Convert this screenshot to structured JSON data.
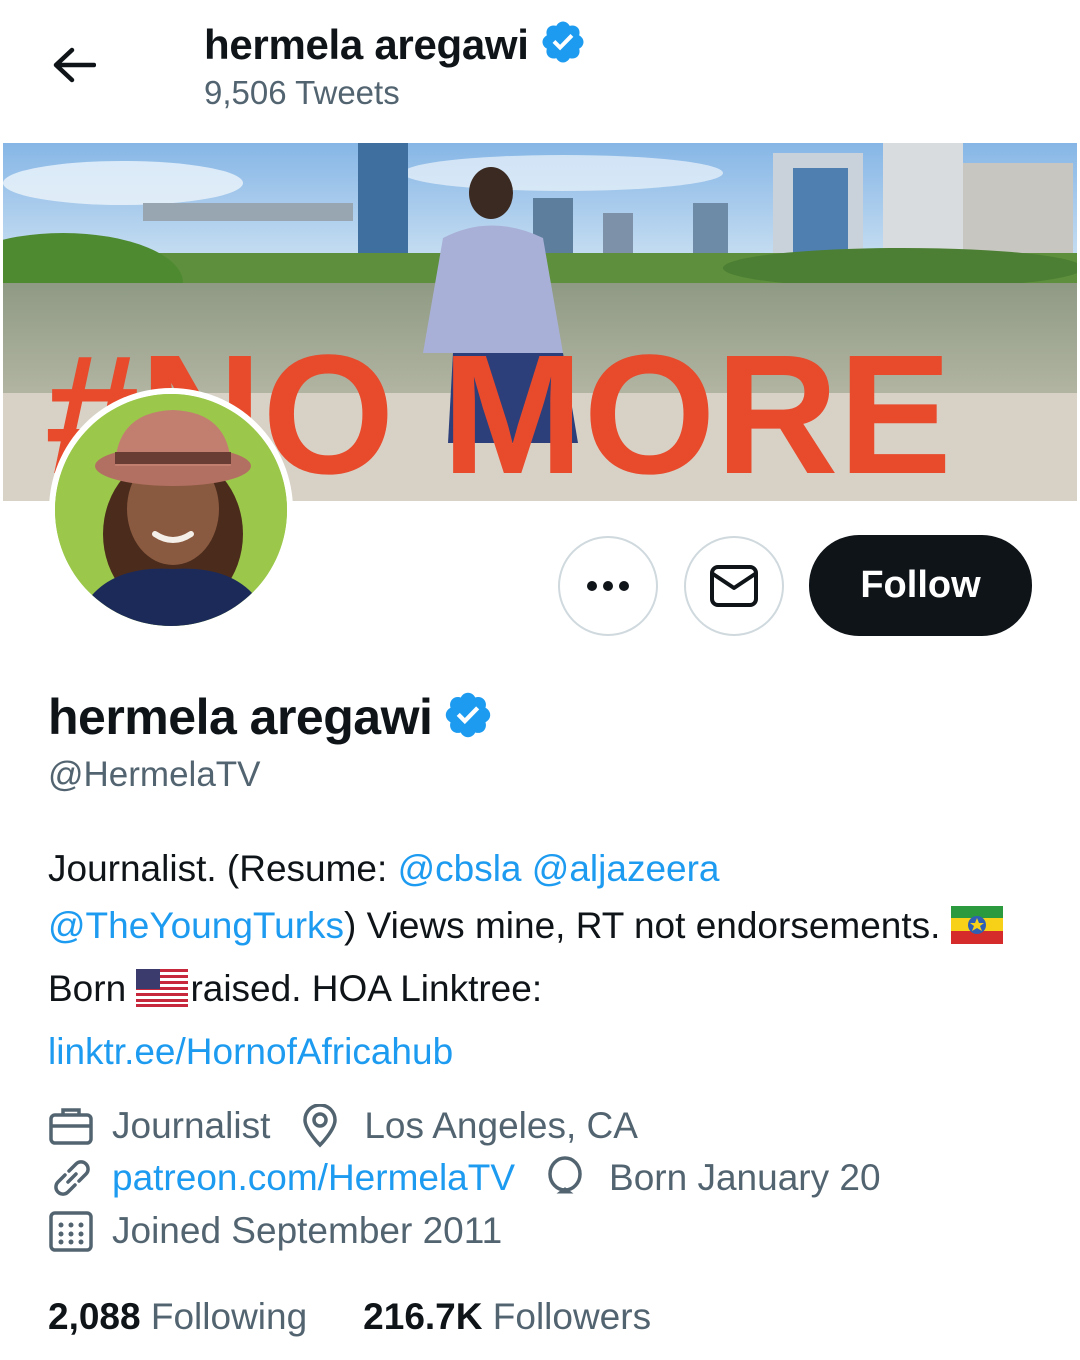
{
  "header": {
    "name": "hermela aregawi",
    "tweet_count": "9,506 Tweets",
    "back_icon": "arrow-left-icon"
  },
  "profile": {
    "name": "hermela aregawi",
    "handle": "@HermelaTV",
    "verified_icon": "verified-badge-icon",
    "banner_text": "#NO MORE"
  },
  "actions": {
    "more_icon": "more-dots-icon",
    "message_icon": "envelope-icon",
    "follow_label": "Follow"
  },
  "bio": {
    "part1": "Journalist. (Resume: ",
    "mention1": "@cbsla",
    "space1": " ",
    "mention2": "@aljazeera",
    "space2": " ",
    "mention3": "@TheYoungTurks",
    "part2": ") Views mine, RT not endorsements. ",
    "part3": "Born ",
    "part4": "raised. HOA Linktree: ",
    "link": "linktr.ee/HornofAfricahub"
  },
  "meta": {
    "profession": "Journalist",
    "location": "Los Angeles, CA",
    "website": "patreon.com/HermelaTV",
    "birthday": "Born January 20",
    "joined": "Joined September 2011"
  },
  "stats": {
    "following_count": "2,088",
    "following_label": " Following",
    "followers_count": "216.7K",
    "followers_label": " Followers"
  },
  "colors": {
    "accent": "#1d9bf0",
    "text": "#0f1419",
    "secondary": "#536471",
    "banner_letters": "#e84a2c"
  }
}
